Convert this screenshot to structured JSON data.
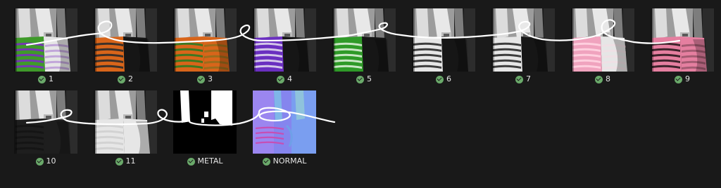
{
  "sync_status_icon": "green-check-circle",
  "items": [
    {
      "label": "1",
      "kind": "dual",
      "left": "#3f9a2a",
      "right": "#e6e6e6",
      "stripe": "#7a2fc0"
    },
    {
      "label": "2",
      "kind": "dual",
      "left": "#d8651a",
      "right": "#161616",
      "stripe": "#2b2b2b"
    },
    {
      "label": "3",
      "kind": "dual",
      "left": "#d8651a",
      "right": "#d8651a",
      "stripe": "#2e7a22"
    },
    {
      "label": "4",
      "kind": "dual",
      "left": "#6a2fc0",
      "right": "#161616",
      "stripe": "#e0d8ec"
    },
    {
      "label": "5",
      "kind": "dual",
      "left": "#2f9a28",
      "right": "#161616",
      "stripe": "#dbeed6"
    },
    {
      "label": "6",
      "kind": "dual",
      "left": "#e6e6e6",
      "right": "#161616",
      "stripe": "#2a2a2a"
    },
    {
      "label": "7",
      "kind": "dual",
      "left": "#e6e6e6",
      "right": "#161616",
      "stripe": "#2a2a2a"
    },
    {
      "label": "8",
      "kind": "dual",
      "left": "#f0a3be",
      "right": "#e6e6e6",
      "stripe": "#ffd4e1"
    },
    {
      "label": "9",
      "kind": "dual",
      "left": "#e57fa0",
      "right": "#e57fa0",
      "stripe": "#2a1a1e"
    },
    {
      "label": "10",
      "kind": "dual",
      "left": "#1e1e1e",
      "right": "#1e1e1e",
      "stripe": "#141414"
    },
    {
      "label": "11",
      "kind": "dual",
      "left": "#e6e6e6",
      "right": "#e6e6e6",
      "stripe": "#cfcfcf"
    },
    {
      "label": "METAL",
      "kind": "metal"
    },
    {
      "label": "NORMAL",
      "kind": "normal"
    }
  ]
}
